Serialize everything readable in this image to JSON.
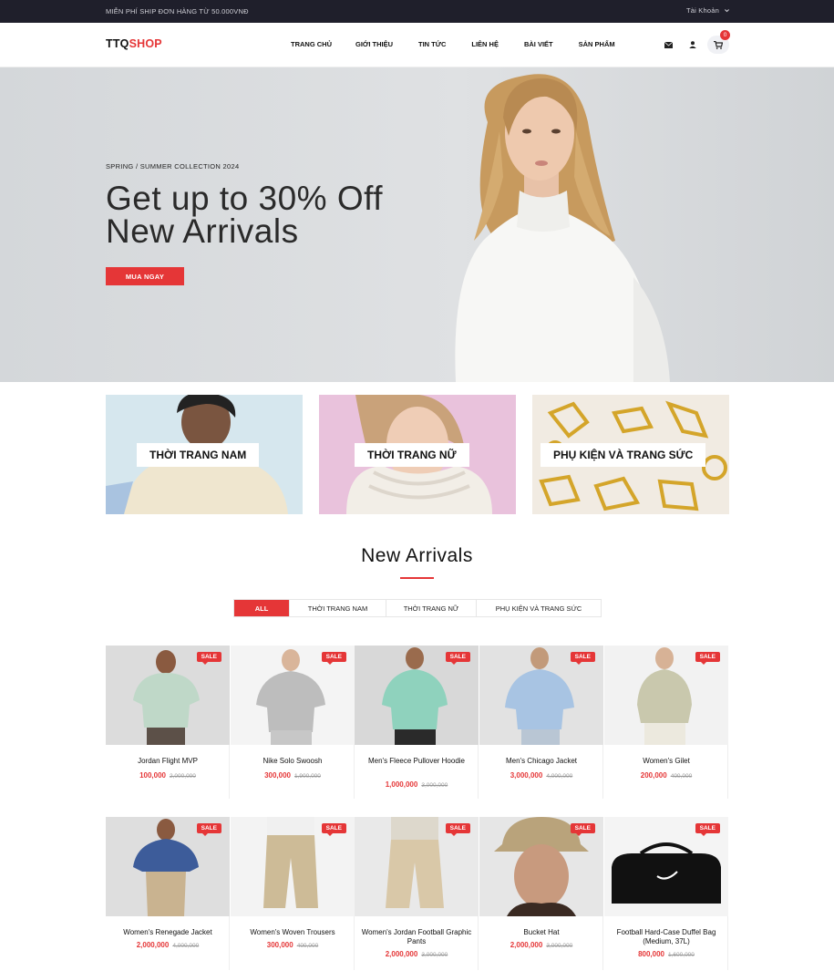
{
  "topbar": {
    "shipping_note": "MIỄN PHÍ SHIP ĐƠN HÀNG TỪ 50.000VNĐ",
    "account_label": "Tài Khoản"
  },
  "header": {
    "logo_part1": "TTQ",
    "logo_part2": "SHOP",
    "nav": [
      "TRANG CHỦ",
      "GIỚI THIỆU",
      "TIN TỨC",
      "LIÊN HỆ",
      "BÀI VIẾT",
      "SẢN PHẨM"
    ],
    "cart_count": "0",
    "icons": [
      "mail-icon",
      "user-icon",
      "cart-icon"
    ]
  },
  "hero": {
    "subtitle": "SPRING / SUMMER COLLECTION 2024",
    "title_line1": "Get up to 30% Off",
    "title_line2": "New Arrivals",
    "cta": "MUA NGAY"
  },
  "categories": [
    "THỜI TRANG NAM",
    "THỜI TRANG NỮ",
    "PHỤ KIỆN VÀ TRANG SỨC"
  ],
  "new_arrivals": {
    "title": "New Arrivals",
    "filters": [
      "ALL",
      "THỜI TRANG NAM",
      "THỜI TRANG NỮ",
      "PHỤ KIỆN VÀ TRANG SỨC"
    ],
    "active_filter": "ALL",
    "sale_badge": "SALE",
    "products": [
      {
        "name": "Jordan Flight MVP",
        "price": "100,000",
        "old_price": "2,000,000"
      },
      {
        "name": "Nike Solo Swoosh",
        "price": "300,000",
        "old_price": "1,900,000"
      },
      {
        "name": "Men's Fleece Pullover Hoodie",
        "price": "1,000,000",
        "old_price": "3,000,000"
      },
      {
        "name": "Men's Chicago Jacket",
        "price": "3,000,000",
        "old_price": "4,000,000"
      },
      {
        "name": "Women's Gilet",
        "price": "200,000",
        "old_price": "400,000"
      },
      {
        "name": "Women's Renegade Jacket",
        "price": "2,000,000",
        "old_price": "4,000,000"
      },
      {
        "name": "Women's Woven Trousers",
        "price": "300,000",
        "old_price": "400,000"
      },
      {
        "name": "Women's Jordan Football Graphic Pants",
        "price": "2,000,000",
        "old_price": "3,000,000"
      },
      {
        "name": "Bucket Hat",
        "price": "2,000,000",
        "old_price": "3,000,000"
      },
      {
        "name": "Football Hard-Case Duffel Bag (Medium, 37L)",
        "price": "800,000",
        "old_price": "1,600,000"
      }
    ]
  },
  "colors": {
    "accent": "#e53637",
    "topbar_bg": "#1f1f2b"
  }
}
